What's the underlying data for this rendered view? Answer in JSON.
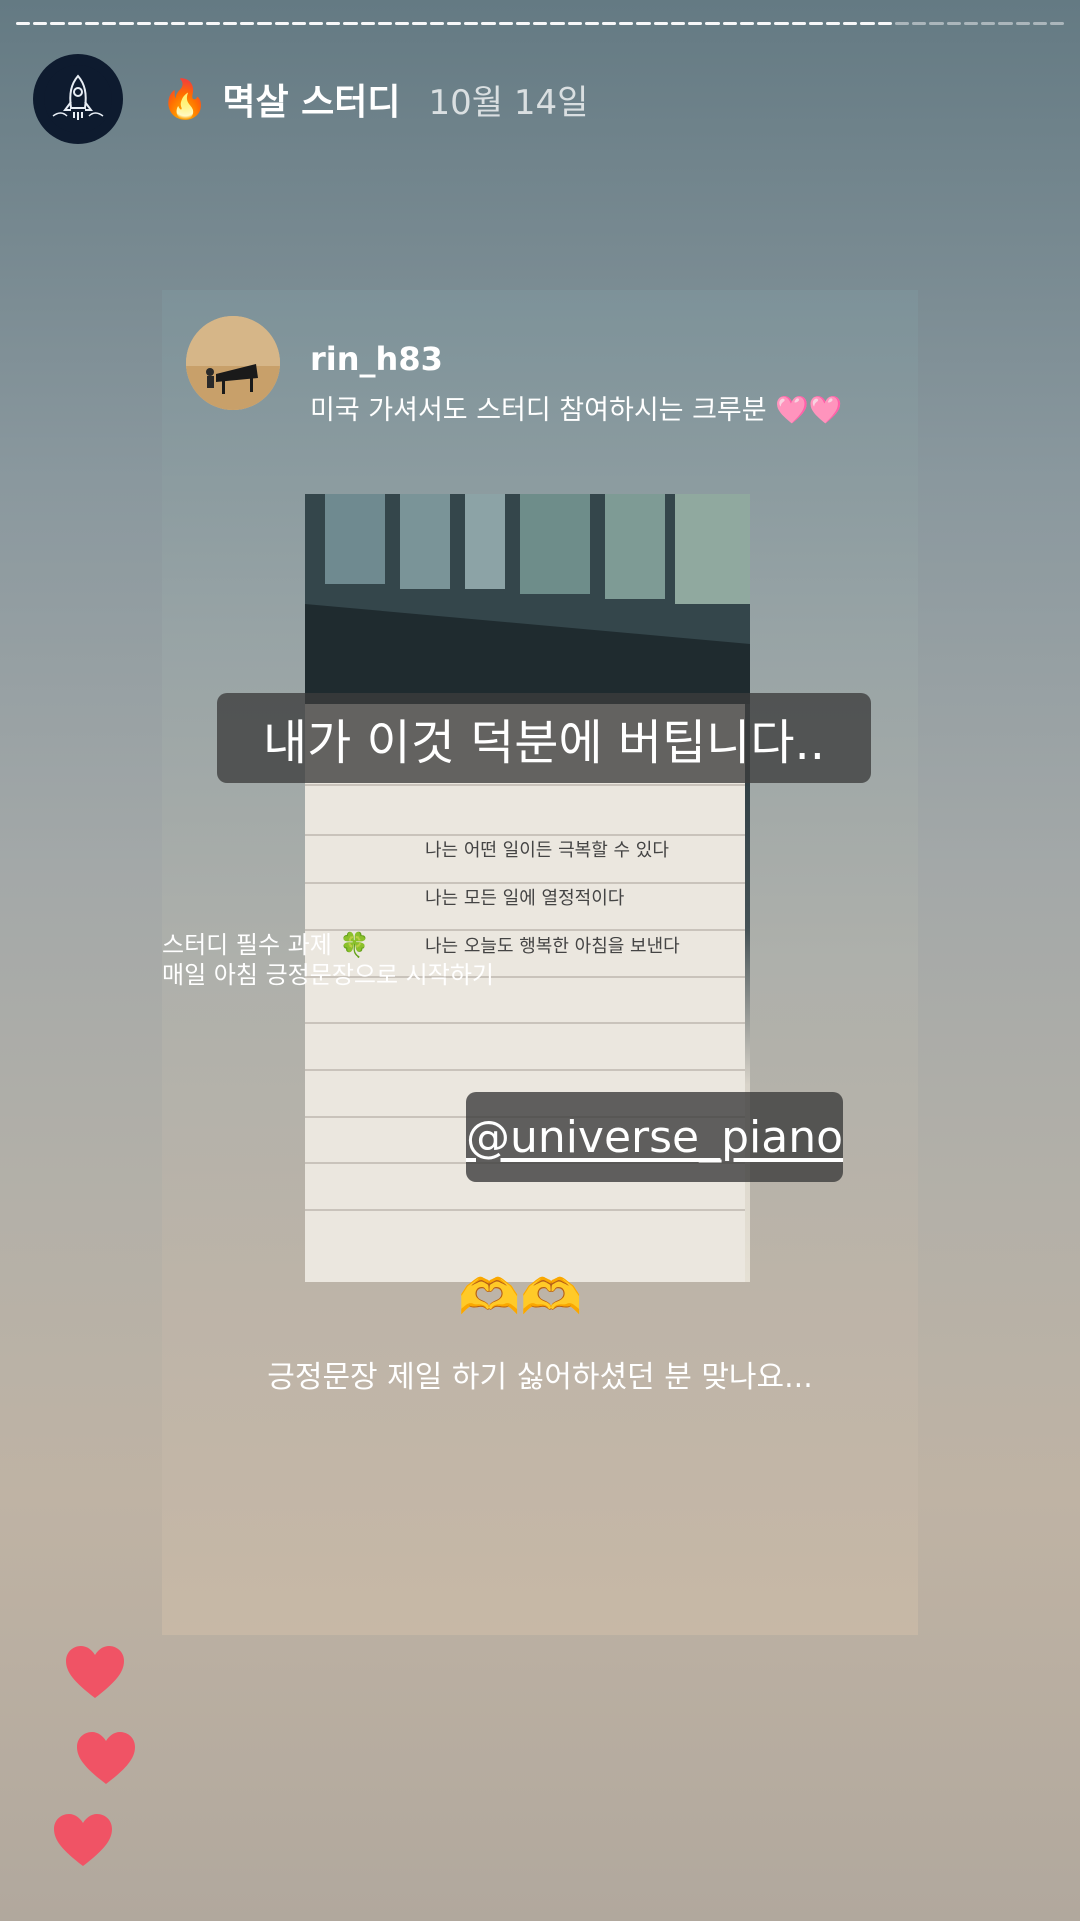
{
  "story": {
    "progress_segments": [
      1,
      1,
      1,
      1,
      1,
      1,
      1,
      1,
      1,
      1,
      1,
      1,
      1,
      1,
      1,
      1,
      1,
      1,
      1,
      1,
      1,
      1,
      1,
      1,
      1,
      1,
      1,
      1,
      1,
      1,
      1,
      1,
      1,
      1,
      1,
      1,
      1,
      1,
      1,
      1,
      1,
      1,
      1,
      1,
      1,
      1,
      1,
      1,
      1,
      1,
      1,
      0,
      0,
      0,
      0,
      0,
      0,
      0,
      0,
      0,
      0
    ],
    "fire_emoji": "🔥",
    "account_name": "멱살 스터디",
    "date": "10월 14일"
  },
  "shared_post": {
    "username": "rin_h83",
    "caption": "미국 가셔서도 스터디 참여하시는 크루분 🩷🩷",
    "big_caption": "내가 이것 덕분에 버팁니다..",
    "mention": "@universe_piano",
    "handwriting": [
      "나는 어떤 일이든 극복할 수 있다",
      "나는 모든 일에 열정적이다",
      "나는 오늘도 행복한 아침을 보낸다"
    ]
  },
  "study_note": {
    "line1": "스터디 필수 과제 🍀",
    "line2": "매일 아침 긍정문장으로 시작하기"
  },
  "bottom": {
    "emoji": "🫶🫶",
    "caption": "긍정문장 제일 하기 싫어하셨던 분 맞나요..."
  },
  "colors": {
    "heart": "#f05365",
    "caption_bg": "#3c3c3c"
  }
}
